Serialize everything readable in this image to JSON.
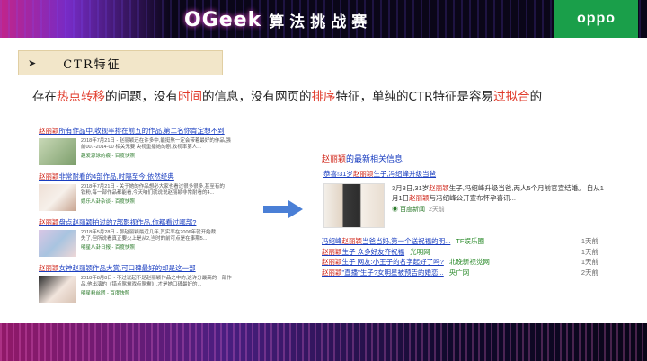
{
  "header": {
    "brand_logo": "OGeek",
    "brand_title": "算法挑战赛",
    "partner_logo": "oppo",
    "colors": {
      "partner_bg": "#1a9f4a",
      "banner_bg": "#0a0618"
    }
  },
  "section": {
    "bullet": "➤",
    "title": "CTR特征"
  },
  "headline": {
    "p1": "存在",
    "h1": "热点转移",
    "p2": "的问题，没有",
    "h2": "时间",
    "p3": "的信息，没有网页的",
    "h3": "排序",
    "p4": "特征，单纯的CTR特征是容易",
    "h4": "过拟合",
    "p5": "的",
    "highlight_color": "#e03a2a"
  },
  "left_results": [
    {
      "kw": "赵丽颖",
      "title": "所有作品中,收视率排在前五的作品,第二名你肯定想不到",
      "text1": "2018年7月21日 - 赵丽颖还在许多中,能挺熬一定会带着最好的作品,强",
      "text2": "前007-2014-00 相关无要 央视重播她的剧,收视率第人...",
      "source": "趣爱源泳的痕 - 百度快照"
    },
    {
      "kw": "赵丽颖",
      "title": "非常耐看的4部作品,时隔至今,依然经典",
      "text1": "2018年7月21日 - 关于她的作品想必大家也看过很多很多,甚至有的",
      "text2": "铁粉,每一部作品都能看,今天咱们就说说赵丽颖非常耐看的4...",
      "source": "娱乐八卦杂谈 - 百度快照"
    },
    {
      "kw": "赵丽颖",
      "title": "盘点赵丽颖拍过的7部影视作品,你都看过哪部?",
      "text1": "2018年5月28日 - 那赵丽颖最近几年,其实率在2006年就开始裁",
      "text2": "失了,但所说看真正要火上是从2,当时的前可点是在事期5...",
      "source": "明星八卦日报 - 百度快照"
    },
    {
      "kw": "赵丽颖",
      "title": "女神赵丽颖作品大赏,可口碑最好的却是这一部",
      "text1": "2018年8月8日 - 不过说起不是赵丽颖作品之中的,这许分最高的一部作",
      "text2": "品,他出演的《错点鸳鸯戏点鸳鸯》,才是她口碑最好的...",
      "source": "明星粉丝团 - 百度快照"
    }
  ],
  "right_panel": {
    "heading_kw": "赵丽颖",
    "heading_rest": "的最新相关信息",
    "sub_pre": "恭喜!31岁",
    "sub_kw": "赵丽颖",
    "sub_post": "生子,冯绍峰升级当爸",
    "feature_p1": "3月8日,31岁",
    "feature_kw1": "赵丽颖",
    "feature_p2": "生子,冯绍峰升级当爸,两人5个月前官宣结婚。 自从1月1日",
    "feature_kw2": "赵丽颖",
    "feature_p3": "与冯绍峰公开宣布怀孕喜讯...",
    "feature_source": "百度新闻",
    "feature_time": "2天前",
    "list": [
      {
        "pre": "冯绍峰",
        "kw": "赵丽颖",
        "post": "当爸当妈,第一个送祝福的明...",
        "source": "TF娱乐圈",
        "time": "1天前"
      },
      {
        "pre": "",
        "kw": "赵丽颖",
        "post": "生子 众多好友齐祝福",
        "source": "光明网",
        "time": "1天前"
      },
      {
        "pre": "",
        "kw": "赵丽颖",
        "post": "生子 网友:小王子的名字起好了吗?",
        "source": "北晚新视觉网",
        "time": "1天前"
      },
      {
        "pre": "",
        "kw": "赵丽颖",
        "post": "\"直播\"生子?女明星被预告的婚恋...",
        "source": "央广网",
        "time": "2天前"
      }
    ]
  }
}
